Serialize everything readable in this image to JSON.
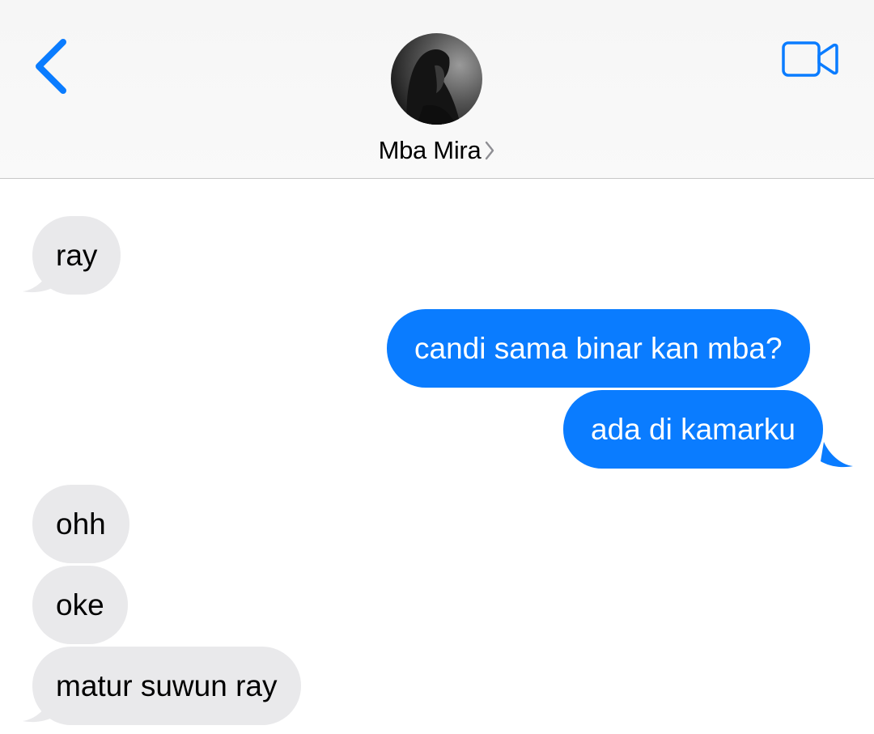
{
  "header": {
    "contact_name": "Mba Mira",
    "back_icon": "chevron-left-icon",
    "video_icon": "video-camera-icon",
    "contact_chevron_icon": "chevron-right-icon"
  },
  "colors": {
    "accent": "#0a7cff",
    "incoming_bubble": "#e9e9eb",
    "outgoing_text": "#ffffff",
    "incoming_text": "#000000"
  },
  "messages": [
    {
      "direction": "incoming",
      "text": "ray"
    },
    {
      "direction": "outgoing",
      "text": "candi sama binar kan mba?"
    },
    {
      "direction": "outgoing",
      "text": "ada di kamarku"
    },
    {
      "direction": "incoming",
      "text": "ohh"
    },
    {
      "direction": "incoming",
      "text": "oke"
    },
    {
      "direction": "incoming",
      "text": "matur suwun ray"
    }
  ]
}
